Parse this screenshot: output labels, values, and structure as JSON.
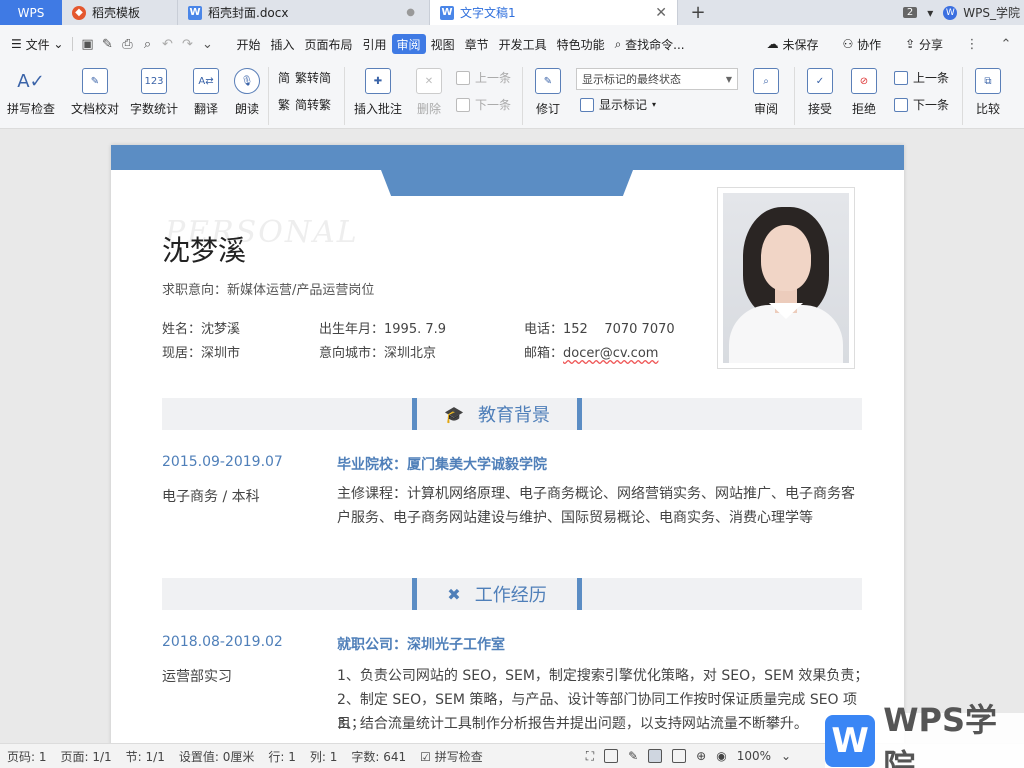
{
  "titlebar": {
    "wps_label": "WPS",
    "tabs": [
      {
        "label": "稻壳模板"
      },
      {
        "label": "稻壳封面.docx"
      },
      {
        "label": "文字文稿1"
      }
    ],
    "window_count": "2",
    "school_label": "WPS_学院"
  },
  "menubar": {
    "file_label": "文件",
    "items": [
      "开始",
      "插入",
      "页面布局",
      "引用",
      "审阅",
      "视图",
      "章节",
      "开发工具",
      "特色功能"
    ],
    "active": "审阅",
    "search_label": "查找命令...",
    "unsaved_label": "未保存",
    "collab_label": "协作",
    "share_label": "分享"
  },
  "ribbon": {
    "spell": "拼写检查",
    "proof": "文档校对",
    "wordcount": "字数统计",
    "translate": "翻译",
    "read": "朗读",
    "trad": "繁转简",
    "simp": "简转繁",
    "insert_comment": "插入批注",
    "delete": "删除",
    "prev_comment": "上一条",
    "next_comment": "下一条",
    "revise": "修订",
    "markup_mode": "显示标记的最终状态",
    "show_markup": "显示标记",
    "review": "审阅",
    "accept": "接受",
    "reject": "拒绝",
    "prev": "上一条",
    "next": "下一条",
    "compare": "比较"
  },
  "resume": {
    "watermark": "PERSONAL",
    "name": "沈梦溪",
    "intent": "求职意向：新媒体运营/产品运营岗位",
    "name_line": "姓名：沈梦溪",
    "residence": "现居：深圳市",
    "birth": "出生年月：1995. 7.9",
    "city": "意向城市：深圳北京",
    "phone": "电话：152    7070 7070",
    "email_label": "邮箱：",
    "email": "docer@cv.com",
    "education": {
      "title": "教育背景",
      "date": "2015.09-2019.07",
      "school": "毕业院校：厦门集美大学诚毅学院",
      "degree": "电子商务 / 本科",
      "courses": "主修课程：计算机网络原理、电子商务概论、网络营销实务、网站推广、电子商务客户服务、电子商务网站建设与维护、国际贸易概论、电商实务、消费心理学等"
    },
    "work": {
      "title": "工作经历",
      "date": "2018.08-2019.02",
      "company": "就职公司：深圳光子工作室",
      "role": "运营部实习",
      "duties": [
        "1、负责公司网站的 SEO，SEM，制定搜索引擎优化策略，对 SEO，SEM 效果负责；",
        "2、制定 SEO，SEM 策略，与产品、设计等部门协同工作按时保证质量完成 SEO 项目；",
        "3、结合流量统计工具制作分析报告并提出问题，以支持网站流量不断攀升。"
      ]
    }
  },
  "statusbar": {
    "page_code": "页码: 1",
    "pages": "页面: 1/1",
    "section": "节: 1/1",
    "setting": "设置值: 0厘米",
    "row": "行: 1",
    "col": "列: 1",
    "words": "字数: 641",
    "spell": "拼写检查",
    "zoom": "100%"
  },
  "brand": {
    "logo_letter": "W",
    "logo_text": "WPS学院",
    "accent": "#3f7ae4",
    "resume_blue": "#5b8dc4"
  }
}
